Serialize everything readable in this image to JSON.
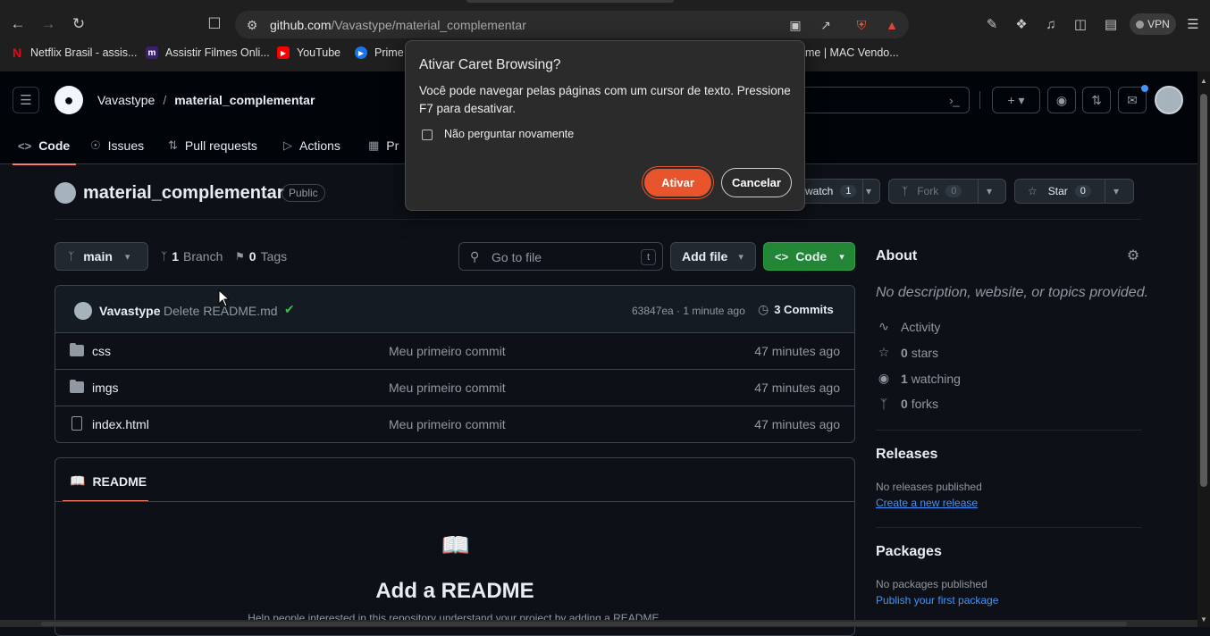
{
  "browser": {
    "url_host": "github.com",
    "url_path": "/Vavastype/material_complementar",
    "vpn_label": "VPN",
    "bookmarks": [
      {
        "label": "Netflix Brasil - assis...",
        "icon": "netflix-icon",
        "color": "#e50914"
      },
      {
        "label": "Assistir Filmes Onli...",
        "icon": "m-icon",
        "color": "#3a1f6e"
      },
      {
        "label": "YouTube",
        "icon": "youtube-icon",
        "color": "#ff0000"
      },
      {
        "label": "Prime",
        "icon": "prime-icon",
        "color": "#1a73e8"
      },
      {
        "label": "me | MAC Vendo...",
        "icon": "",
        "color": ""
      }
    ]
  },
  "dialog": {
    "title": "Ativar Caret Browsing?",
    "body": "Você pode navegar pelas páginas com um cursor de texto. Pressione F7 para desativar.",
    "checkbox_label": "Não perguntar novamente",
    "ok_label": "Ativar",
    "cancel_label": "Cancelar",
    "accent": "#e8542b"
  },
  "header": {
    "owner": "Vavastype",
    "separator": "/",
    "repo": "material_complementar"
  },
  "repo_nav": [
    {
      "label": "Code",
      "icon": "code-icon"
    },
    {
      "label": "Issues",
      "icon": "issue-icon"
    },
    {
      "label": "Pull requests",
      "icon": "pull-request-icon"
    },
    {
      "label": "Actions",
      "icon": "play-icon"
    },
    {
      "label": "Pr",
      "icon": "project-icon"
    }
  ],
  "repo": {
    "name": "material_complementar",
    "visibility": "Public",
    "watch_label": "watch",
    "watch_count": "1",
    "fork_label": "Fork",
    "fork_count": "0",
    "star_label": "Star",
    "star_count": "0"
  },
  "file_nav": {
    "branch": "main",
    "branches_count": "1",
    "branches_label": "Branch",
    "tags_count": "0",
    "tags_label": "Tags",
    "search_placeholder": "Go to file",
    "search_key": "t",
    "add_file_label": "Add file",
    "code_label": "Code"
  },
  "latest_commit": {
    "author": "Vavastype",
    "message": "Delete README.md",
    "meta": "63847ea · 1 minute ago",
    "commits_label": "3 Commits"
  },
  "files": [
    {
      "name": "css",
      "type": "folder",
      "commit": "Meu primeiro commit",
      "time": "47 minutes ago"
    },
    {
      "name": "imgs",
      "type": "folder",
      "commit": "Meu primeiro commit",
      "time": "47 minutes ago"
    },
    {
      "name": "index.html",
      "type": "file",
      "commit": "Meu primeiro commit",
      "time": "47 minutes ago"
    }
  ],
  "readme": {
    "tab_label": "README",
    "heading": "Add a README",
    "text": "Help people interested in this repository understand your project by adding a README."
  },
  "about": {
    "title": "About",
    "description": "No description, website, or topics provided.",
    "activity_label": "Activity",
    "stars_count": "0",
    "stars_label": "stars",
    "watching_count": "1",
    "watching_label": "watching",
    "forks_count": "0",
    "forks_label": "forks"
  },
  "releases": {
    "title": "Releases",
    "empty": "No releases published",
    "link": "Create a new release"
  },
  "packages": {
    "title": "Packages",
    "empty": "No packages published",
    "link": "Publish your first package"
  }
}
